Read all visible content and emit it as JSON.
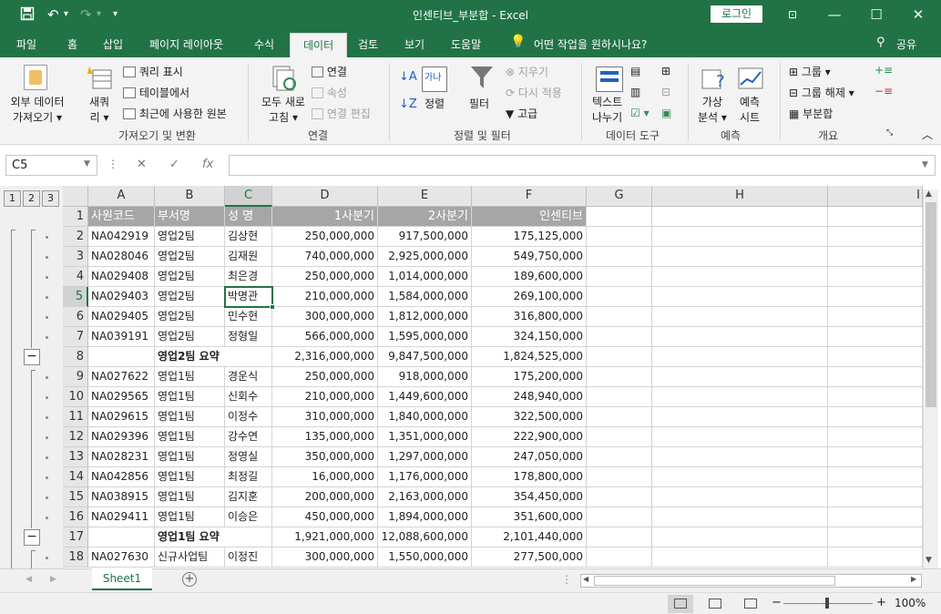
{
  "titlebar": {
    "title": "인센티브_부분합 - Excel",
    "login": "로그인",
    "save_icon": "save-icon",
    "undo_icon": "undo-icon",
    "redo_icon": "redo-icon"
  },
  "tabs": [
    "파일",
    "홈",
    "삽입",
    "페이지 레이아웃",
    "수식",
    "데이터",
    "검토",
    "보기",
    "도움말"
  ],
  "tell_me": "어떤 작업을 원하시나요?",
  "share": "공유",
  "ribbon": {
    "get_external": "외부 데이터\n가져오기",
    "get_external_l1": "외부 데이터",
    "get_external_l2": "가져오기",
    "new_query_l1": "새쿼",
    "new_query_l2": "리",
    "show_queries": "쿼리 표시",
    "from_table": "테이블에서",
    "recent_sources": "최근에 사용한 원본",
    "group1": "가져오기 및 변환",
    "refresh_l1": "모두 새로",
    "refresh_l2": "고침",
    "connections": "연결",
    "properties": "속성",
    "edit_links": "연결 편집",
    "group2": "연결",
    "sort": "정렬",
    "filter": "필터",
    "clear": "지우기",
    "reapply": "다시 적용",
    "advanced": "고급",
    "group3": "정렬 및 필터",
    "text_to_columns_l1": "텍스트",
    "text_to_columns_l2": "나누기",
    "group4": "데이터 도구",
    "whatif_l1": "가상",
    "whatif_l2": "분석",
    "forecast_l1": "예측",
    "forecast_l2": "시트",
    "group5": "예측",
    "group_btn": "그룹",
    "ungroup_btn": "그룹 해제",
    "subtotal_btn": "부분합",
    "group6": "개요"
  },
  "namebox": "C5",
  "fx": "fx",
  "columns": [
    "A",
    "B",
    "C",
    "D",
    "E",
    "F",
    "G",
    "H",
    "I"
  ],
  "outline_levels": [
    "1",
    "2",
    "3"
  ],
  "rows": [
    {
      "n": "1",
      "a": "사원코드",
      "b": "부서명",
      "c": "성  명",
      "d": "1사분기",
      "e": "2사분기",
      "f": "인센티브",
      "type": "header"
    },
    {
      "n": "2",
      "a": "NA042919",
      "b": "영업2팀",
      "c": "김상현",
      "d": "250,000,000",
      "e": "917,500,000",
      "f": "175,125,000"
    },
    {
      "n": "3",
      "a": "NA028046",
      "b": "영업2팀",
      "c": "김재원",
      "d": "740,000,000",
      "e": "2,925,000,000",
      "f": "549,750,000"
    },
    {
      "n": "4",
      "a": "NA029408",
      "b": "영업2팀",
      "c": "최은경",
      "d": "250,000,000",
      "e": "1,014,000,000",
      "f": "189,600,000"
    },
    {
      "n": "5",
      "a": "NA029403",
      "b": "영업2팀",
      "c": "박명관",
      "d": "210,000,000",
      "e": "1,584,000,000",
      "f": "269,100,000"
    },
    {
      "n": "6",
      "a": "NA029405",
      "b": "영업2팀",
      "c": "민수현",
      "d": "300,000,000",
      "e": "1,812,000,000",
      "f": "316,800,000"
    },
    {
      "n": "7",
      "a": "NA039191",
      "b": "영업2팀",
      "c": "정형일",
      "d": "566,000,000",
      "e": "1,595,000,000",
      "f": "324,150,000"
    },
    {
      "n": "8",
      "a": "",
      "b": "영업2팀 요약",
      "c": "",
      "d": "2,316,000,000",
      "e": "9,847,500,000",
      "f": "1,824,525,000",
      "type": "summary"
    },
    {
      "n": "9",
      "a": "NA027622",
      "b": "영업1팀",
      "c": "경운식",
      "d": "250,000,000",
      "e": "918,000,000",
      "f": "175,200,000"
    },
    {
      "n": "10",
      "a": "NA029565",
      "b": "영업1팀",
      "c": "신회수",
      "d": "210,000,000",
      "e": "1,449,600,000",
      "f": "248,940,000"
    },
    {
      "n": "11",
      "a": "NA029615",
      "b": "영업1팀",
      "c": "이정수",
      "d": "310,000,000",
      "e": "1,840,000,000",
      "f": "322,500,000"
    },
    {
      "n": "12",
      "a": "NA029396",
      "b": "영업1팀",
      "c": "강수연",
      "d": "135,000,000",
      "e": "1,351,000,000",
      "f": "222,900,000"
    },
    {
      "n": "13",
      "a": "NA028231",
      "b": "영업1팀",
      "c": "정영실",
      "d": "350,000,000",
      "e": "1,297,000,000",
      "f": "247,050,000"
    },
    {
      "n": "14",
      "a": "NA042856",
      "b": "영업1팀",
      "c": "최정길",
      "d": "16,000,000",
      "e": "1,176,000,000",
      "f": "178,800,000"
    },
    {
      "n": "15",
      "a": "NA038915",
      "b": "영업1팀",
      "c": "김지훈",
      "d": "200,000,000",
      "e": "2,163,000,000",
      "f": "354,450,000"
    },
    {
      "n": "16",
      "a": "NA029411",
      "b": "영업1팀",
      "c": "이승은",
      "d": "450,000,000",
      "e": "1,894,000,000",
      "f": "351,600,000"
    },
    {
      "n": "17",
      "a": "",
      "b": "영업1팀 요약",
      "c": "",
      "d": "1,921,000,000",
      "e": "12,088,600,000",
      "f": "2,101,440,000",
      "type": "summary"
    },
    {
      "n": "18",
      "a": "NA027630",
      "b": "신규사업팀",
      "c": "이정진",
      "d": "300,000,000",
      "e": "1,550,000,000",
      "f": "277,500,000"
    }
  ],
  "sheet_tab": "Sheet1",
  "zoom": "100%",
  "colors": {
    "accent": "#217346",
    "header_fill": "#a6a6a6"
  }
}
